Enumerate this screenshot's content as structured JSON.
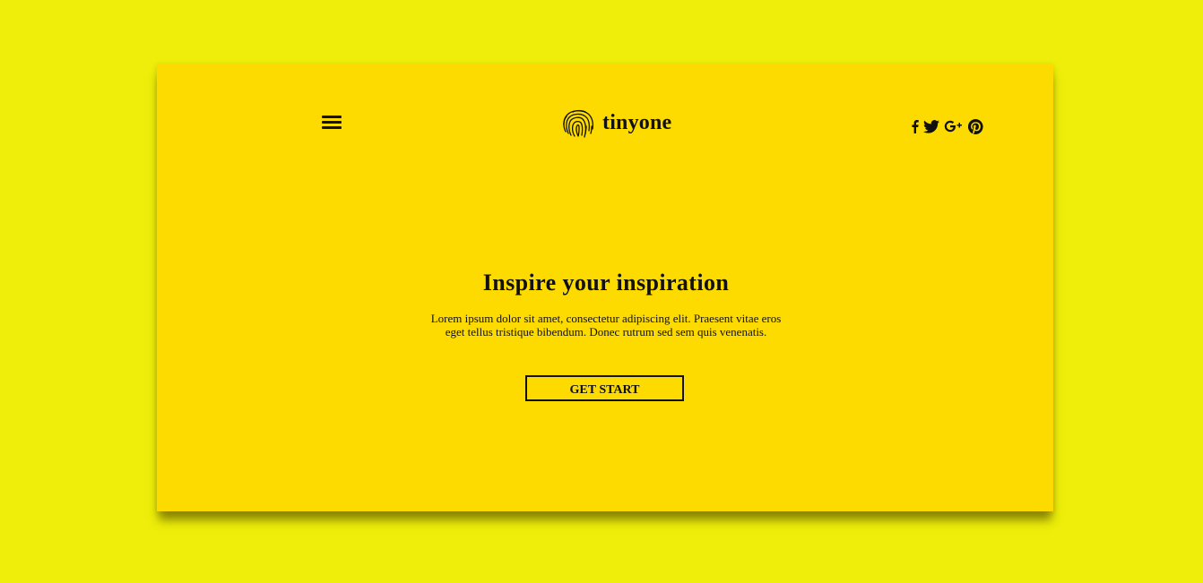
{
  "colors": {
    "page_background": "#eeee0a",
    "card_background": "#fddb00",
    "ink": "#111111"
  },
  "header": {
    "menu_icon": "hamburger-menu-icon",
    "brand": {
      "logo_icon": "fingerprint-icon",
      "name": "tinyone"
    },
    "social_icons": [
      "facebook-icon",
      "twitter-icon",
      "google-plus-icon",
      "pinterest-icon"
    ]
  },
  "hero": {
    "title": "Inspire your inspiration",
    "body": "Lorem ipsum dolor sit amet, consectetur adipiscing elit. Praesent vitae eros eget tellus tristique bibendum. Donec rutrum sed sem quis venenatis.",
    "cta_label": "GET START"
  }
}
